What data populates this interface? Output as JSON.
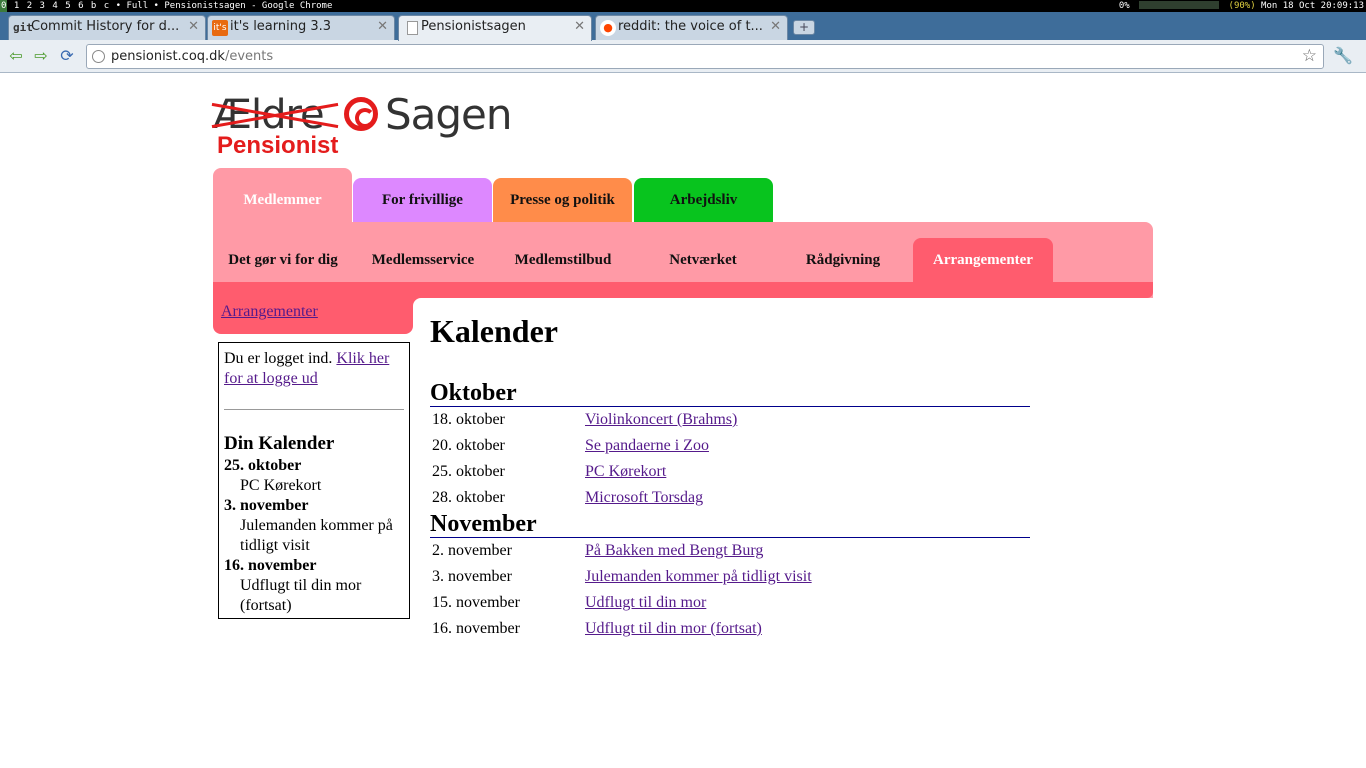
{
  "wm": {
    "workspaces": [
      "0",
      "1",
      "2",
      "3",
      "4",
      "5",
      "6",
      "b",
      "c"
    ],
    "layout": "Full",
    "window_title": "Pensionistsagen - Google Chrome",
    "cpu": "0%",
    "battery": "(90%)",
    "clock": "Mon 18 Oct 20:09:13"
  },
  "browser": {
    "tabs": [
      {
        "title": "Commit History for d...",
        "icon": "git-icon"
      },
      {
        "title": "it's learning 3.3",
        "icon": "itslearning-icon"
      },
      {
        "title": "Pensionistsagen",
        "icon": "page-icon"
      },
      {
        "title": "reddit: the voice of t...",
        "icon": "reddit-icon"
      }
    ],
    "url_host": "pensionist.coq.dk",
    "url_path": "/events"
  },
  "site": {
    "logo": {
      "word1": "Ældre",
      "word2": "Sagen",
      "sub": "Pensionist"
    },
    "top_tabs": [
      "Medlemmer",
      "For frivillige",
      "Presse og politik",
      "Arbejdsliv"
    ],
    "sub_nav": [
      "Det gør vi for dig",
      "Medlemsservice",
      "Medlemstilbud",
      "Netværket",
      "Rådgivning",
      "Arrangementer"
    ],
    "breadcrumb": "Arrangementer",
    "colors": {
      "pink": "#ff9aa6",
      "red": "#ff5c6e",
      "violet": "#dd88ff",
      "orange": "#ff8c4a",
      "green": "#08c41e"
    }
  },
  "sidebar": {
    "logged_in_text": "Du er logget ind.",
    "logout_link": "Klik her for at logge ud",
    "heading": "Din Kalender",
    "entries": [
      {
        "date": "25. oktober",
        "event": "PC Kørekort"
      },
      {
        "date": "3. november",
        "event": "Julemanden kommer på tidligt visit"
      },
      {
        "date": "16. november",
        "event": "Udflugt til din mor (fortsat)"
      }
    ]
  },
  "main": {
    "title": "Kalender",
    "months": [
      {
        "name": "Oktober",
        "events": [
          {
            "date": "18. oktober",
            "title": "Violinkoncert (Brahms)"
          },
          {
            "date": "20. oktober",
            "title": "Se pandaerne i Zoo"
          },
          {
            "date": "25. oktober",
            "title": "PC Kørekort"
          },
          {
            "date": "28. oktober",
            "title": "Microsoft Torsdag"
          }
        ]
      },
      {
        "name": "November",
        "events": [
          {
            "date": "2. november",
            "title": "På Bakken med Bengt Burg"
          },
          {
            "date": "3. november",
            "title": "Julemanden kommer på tidligt visit"
          },
          {
            "date": "15. november",
            "title": "Udflugt til din mor"
          },
          {
            "date": "16. november",
            "title": "Udflugt til din mor (fortsat)"
          }
        ]
      }
    ]
  }
}
